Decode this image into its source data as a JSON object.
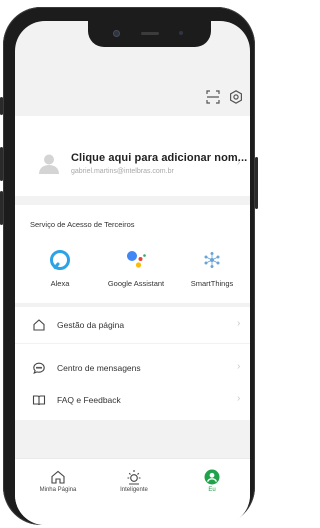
{
  "profile": {
    "name": "Clique aqui para adicionar nom...",
    "email": "gabriel.martins@intelbras.com.br"
  },
  "services": {
    "title": "Serviço de Acesso de Terceiros",
    "items": [
      {
        "label": "Alexa",
        "icon": "alexa-icon"
      },
      {
        "label": "Google Assistant",
        "icon": "google-assistant-icon"
      },
      {
        "label": "SmartThings",
        "icon": "smartthings-icon"
      }
    ]
  },
  "menu": {
    "page_management": "Gestão da página",
    "message_center": "Centro de mensagens",
    "faq": "FAQ e Feedback"
  },
  "tabs": [
    {
      "label": "Minha Página",
      "icon": "home-icon",
      "active": false
    },
    {
      "label": "Inteligente",
      "icon": "sun-icon",
      "active": false
    },
    {
      "label": "Eu",
      "icon": "person-icon",
      "active": true
    }
  ],
  "colors": {
    "accent": "#1fa24a",
    "alexa": "#2ba3e6",
    "background": "#f2f2f2"
  }
}
